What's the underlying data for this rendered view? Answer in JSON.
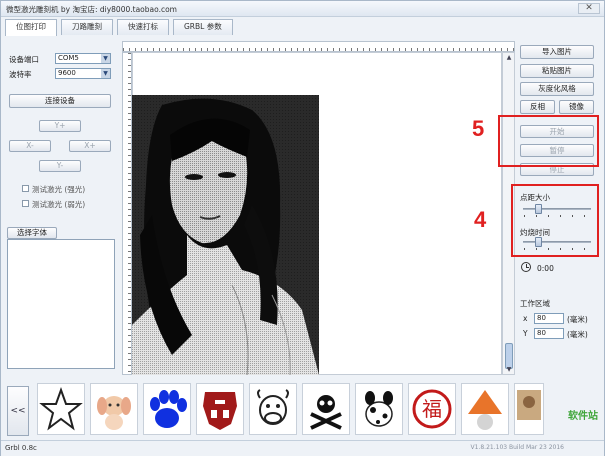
{
  "window": {
    "title": "微型激光雕刻机 by 淘宝店:  diy8000.taobao.com"
  },
  "tabs": [
    {
      "label": "位图打印",
      "active": true
    },
    {
      "label": "刀路雕刻",
      "active": false
    },
    {
      "label": "快速打标",
      "active": false
    },
    {
      "label": "GRBL 参数",
      "active": false
    }
  ],
  "left": {
    "port_label": "设备端口",
    "port_value": "COM5",
    "baud_label": "波特率",
    "baud_value": "9600",
    "connect_label": "连接设备",
    "jog": {
      "y_plus": "Y+",
      "x_minus": "X-",
      "x_plus": "X+",
      "y_minus": "Y-"
    },
    "test_strong": "测试激光 (强光)",
    "test_weak": "测试激光 (弱光)",
    "font_button": "选择字体"
  },
  "right": {
    "import_image": "导入图片",
    "paste_image": "粘贴图片",
    "gray_style": "灰度化风格",
    "invert": "反相",
    "mirror": "镜像",
    "start": "开始",
    "pause": "暂停",
    "stop": "停止",
    "dot_size_label": "点距大小",
    "dot_size_level": 0.2,
    "burn_time_label": "灼烧时间",
    "burn_time_level": 0.2,
    "timer": "0:00",
    "work_area_label": "工作区域",
    "x_label": "x",
    "x_value": "80",
    "x_unit": "(毫米)",
    "y_label": "Y",
    "y_value": "80",
    "y_unit": "(毫米)"
  },
  "annotations": {
    "five": "5",
    "four": "4",
    "color": "#e02020"
  },
  "thumbnails": {
    "prev": "<<",
    "items": [
      "star-icon",
      "dog-icon",
      "paw-icon",
      "robot-logo-icon",
      "cow-icon",
      "skull-icon",
      "dalmatian-icon",
      "fu-character-icon",
      "stop-sign-icon",
      "photo-icon"
    ]
  },
  "status": {
    "version": "Grbl 0.8c",
    "build": "V1.8.21.103 Build Mar 23 2016",
    "watermark": "软件站"
  }
}
